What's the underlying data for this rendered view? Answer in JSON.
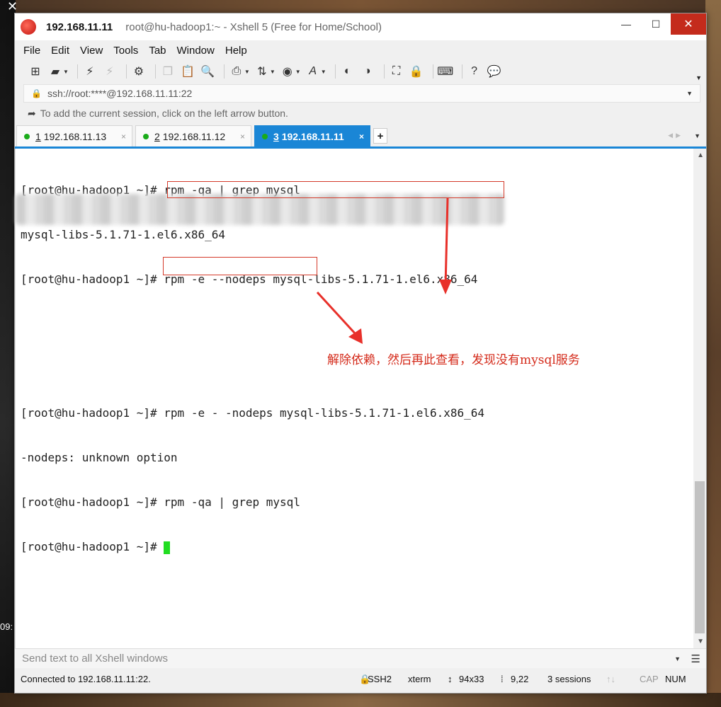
{
  "window": {
    "title_ip": "192.168.11.11",
    "title_rest": "root@hu-hadoop1:~ - Xshell 5 (Free for Home/School)",
    "minimize": "—",
    "maximize": "☐",
    "close": "✕"
  },
  "menu": [
    "File",
    "Edit",
    "View",
    "Tools",
    "Tab",
    "Window",
    "Help"
  ],
  "address": {
    "text": "ssh://root:****@192.168.11.11:22"
  },
  "hint": {
    "text": "To add the current session, click on the left arrow button."
  },
  "tabs": [
    {
      "num": "1",
      "label": "192.168.11.13"
    },
    {
      "num": "2",
      "label": "192.168.11.12"
    },
    {
      "num": "3",
      "label": "192.168.11.11"
    }
  ],
  "terminal": {
    "lines": [
      "[root@hu-hadoop1 ~]# rpm -qa | grep mysql",
      "mysql-libs-5.1.71-1.el6.x86_64",
      "[root@hu-hadoop1 ~]# rpm -e --nodeps mysql-libs-5.1.71-1.el6.x86_64",
      "",
      "",
      "[root@hu-hadoop1 ~]# rpm -e - -nodeps mysql-libs-5.1.71-1.el6.x86_64",
      "-nodeps: unknown option",
      "[root@hu-hadoop1 ~]# rpm -qa | grep mysql",
      "[root@hu-hadoop1 ~]# "
    ],
    "annotation": "解除依赖，然后再此查看，发现没有mysql服务"
  },
  "sendbar": {
    "placeholder": "Send text to all Xshell windows"
  },
  "status": {
    "connected": "Connected to 192.168.11.11:22.",
    "protocol": "SSH2",
    "term": "xterm",
    "size": "94x33",
    "cursor": "9,22",
    "sessions": "3 sessions",
    "cap": "CAP",
    "num": "NUM"
  },
  "desktop": {
    "clock_fragment": "09:"
  },
  "colors": {
    "accent": "#1a86d6",
    "annotation_red": "#d42a1a",
    "cursor_green": "#22dd22",
    "connected_dot": "#1aab1a"
  }
}
